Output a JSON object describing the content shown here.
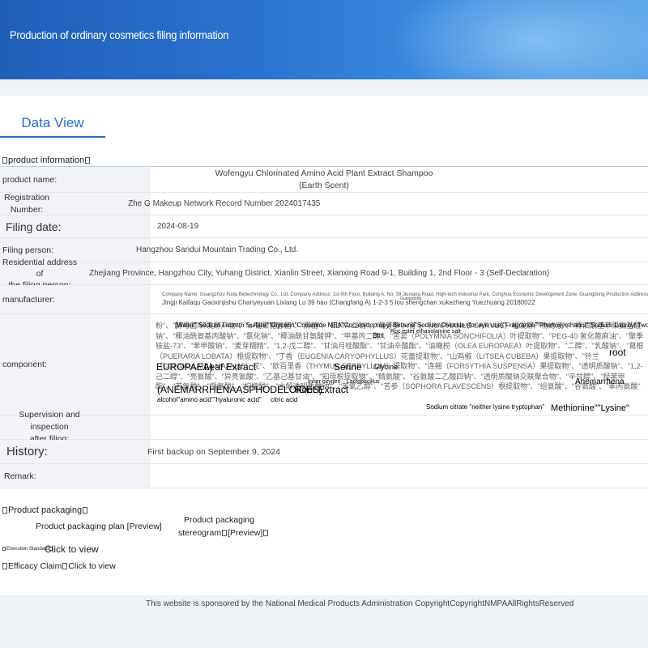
{
  "header": {
    "title": "Production of ordinary cosmetics filing information"
  },
  "tabs": {
    "active": "Data View"
  },
  "product_info": {
    "section_title": "product information",
    "rows": {
      "product_name": {
        "label": "product name:",
        "value_line1": "Wofengyu Chlorinated Amino Acid Plant Extract Shampoo",
        "value_line2": "(Earth Scent)"
      },
      "registration": {
        "label_line1": "Registration",
        "label_line2": "Number:",
        "value": "Zhe G Makeup Network Record Number 2024017435"
      },
      "filing_date": {
        "label": "Filing date:",
        "value": "2024-08-19"
      },
      "filing_person": {
        "label": "Filing person:",
        "value": "Hangzhou Sandui Mountain Trading Co., Ltd."
      },
      "address": {
        "label_line1": "Residential address of",
        "label_line2": "the filing person:",
        "value": "Zhejiang Province, Hangzhou City, Yuhang District, Xianlin Street, Xianxing Road 9-1, Building 1, 2nd Floor - 3 (Self-Declaration)"
      },
      "manufacturer": {
        "label": "manufacturer:",
        "line1": "Company Name: Guangzhou Fuda Biotechnology Co., Ltd. Company Address: 1st-5th Floor, Building A, No. 39 Jiuxiang Road, High-tech Industrial Park, Conghua Economic Development Zone, Guangdong Production Address: Conghua",
        "line2": "Jingji Kaifaqu Gaoxinjishu Chanyeyuan Lixiang Lu 39 hao (Changfang A) 1-2-3 5 lou shengchan xukezheng Yuezhuang 20180022",
        "small": "Guangdong"
      },
      "component": {
        "label": "component:",
        "bg_text": "粉\"、\"酵母菌/锌发酵产物\"、\"α-葡聚糖寡糖\"、\"黑糖\"、\"EDTA 二钠\"、\"萌芽萝卜/芽卜（RAPHANUS SATIVUS）根发酵产物滤液\"、\"椰油酰基苹果氨基酸钠\"、\"椰油酰氨基丙酸钠\"、\"氯化钠\"、\"椰油酰甘氨酸钾\"、\"甲基丙二醇\"、\"苦荬（POLYMNIA SONCHIFOLIA）叶提取物\"、\"PEG-40 氢化蓖麻油\"、\"聚季铵盐-73\"、\"苯甲酸钠\"、\"麦芽糊精\"、\"1,2-戊二醇\"、\"甘油月桂酸酯\"、\"甘油辛酸酯\"、\"油橄榄（OLEA EUROPAEA）叶提取物\"、\"二醇\"、\"乳酸钠\"、\"葛根（PUERARIA LOBATA）根提取物\"、\"丁香（EUGENIA CARYOPHYLLUS）花蕾提取物\"、\"山鸡椒（LITSEA CUBEBA）果提取物\"、\"铃兰（CONVALLARIA MAJALIS）花\"、\"欧百里香（THYMUS SERPYLLUM）提取物\"、\"连翘（FORSYTHIA SUSPENSA）果提取物\"、\"透明质酸钠\"、\"1,2-己二醇\"、\"亮氨酸\"、\"异亮氨酸\"、\"乙基己基甘油\"、\"知母根提取物\"、\"精氨酸\"、\"谷氨酸二乙酸四钠\"、\"透明质酸钠交联聚合物\"、\"辛甘醇\"、\"羟苯甲酯\"、\"苏氨酸\"、\"缬氨酸\"、\"柠檬酸\"、\"水解透明质酸钠\"、\"苯氧乙醇\"、\"苦参（SOPHORA FLAVESCENS）根提取物\"、\"组氨酸\"、\"谷氨酸\"、\"苯丙氨酸\"",
        "ov": {
          "t1": "[Water\"\"Sodium Laureth Sulfate\"\"Glycerin\"Cocamide MEA\"Cocamidopropyl Betaine\"Sodium Chloride (for eye use)\"Fragrance\"\"Phenoxyethanol\"\"Sodium Lauroyl Two",
          "t2": "Diol",
          "t3": "Roc ester ethanolamine salt",
          "t4": "root",
          "t5": "EUROPAEA)",
          "t6": "Leaf Extract",
          "t7": "Serine",
          "t8": "Glycine",
          "t9": "Inner oxygen",
          "t10": "Lactobacillus",
          "t11": "Anemarrhena",
          "t12": "(ANEMARRHENAASPHODELOIDES)",
          "t13": "Root Extract",
          "t14": "alcohol\"amino acid\"\"hyaluronic acid\"",
          "t15": "citric acid",
          "t16": "Sodium citrate \"neither lysine tryptophan\"",
          "t17": "Methionine\"\"Lysine\""
        }
      },
      "supervision": {
        "label_line1": "Supervision and inspection",
        "label_line2": "after filing:",
        "value": ""
      },
      "history": {
        "label": "History:",
        "value": "First backup on September 9, 2024"
      },
      "remark": {
        "label": "Remark:",
        "value": ""
      }
    }
  },
  "packaging": {
    "section_title": "Product packaging",
    "plan_preview": "Product packaging plan [Preview]",
    "stereogram_line1": "Product packaging",
    "stereogram_line2": "stereogram",
    "stereogram_preview": "[Preview]"
  },
  "execution_standard": {
    "label": "Execution Standard",
    "link": "Click to view"
  },
  "efficacy_claim": {
    "label": "Efficacy Claim",
    "link": "Click to view"
  },
  "footer": {
    "text": "This website is sponsored by the National Medical Products Administration CopyrightCopyrightNMPAAllRightsReserved"
  }
}
